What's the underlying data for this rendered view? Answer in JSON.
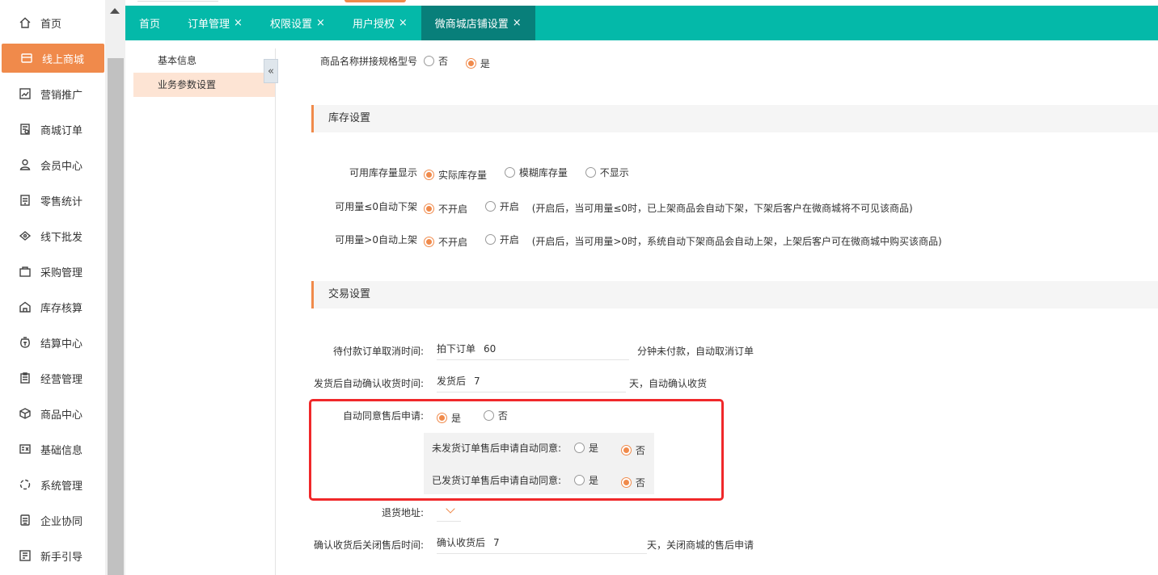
{
  "sidebar": {
    "items": [
      {
        "label": "首页",
        "icon": "home-icon"
      },
      {
        "label": "线上商城",
        "icon": "store-icon",
        "active": true
      },
      {
        "label": "营销推广",
        "icon": "chart-icon"
      },
      {
        "label": "商城订单",
        "icon": "order-icon"
      },
      {
        "label": "会员中心",
        "icon": "user-icon"
      },
      {
        "label": "零售统计",
        "icon": "stats-icon"
      },
      {
        "label": "线下批发",
        "icon": "wholesale-icon"
      },
      {
        "label": "采购管理",
        "icon": "bag-icon"
      },
      {
        "label": "库存核算",
        "icon": "warehouse-icon"
      },
      {
        "label": "结算中心",
        "icon": "money-icon"
      },
      {
        "label": "经营管理",
        "icon": "clipboard-icon"
      },
      {
        "label": "商品中心",
        "icon": "box-icon"
      },
      {
        "label": "基础信息",
        "icon": "id-card-icon"
      },
      {
        "label": "系统管理",
        "icon": "system-icon"
      },
      {
        "label": "企业协同",
        "icon": "cooperation-icon"
      },
      {
        "label": "新手引导",
        "icon": "guide-icon"
      }
    ]
  },
  "tabs": [
    {
      "label": "首页",
      "closable": false
    },
    {
      "label": "订单管理",
      "closable": true
    },
    {
      "label": "权限设置",
      "closable": true
    },
    {
      "label": "用户授权",
      "closable": true
    },
    {
      "label": "微商城店铺设置",
      "closable": true,
      "active": true
    }
  ],
  "tab_close_glyph": "×",
  "subnav": {
    "items": [
      "基本信息",
      "业务参数设置"
    ],
    "collapse_glyph": "«"
  },
  "content": {
    "product_name": {
      "label": "商品名称拼接规格型号",
      "options": [
        "否",
        "是"
      ],
      "selected": 1
    },
    "stock_section": {
      "title": "库存设置"
    },
    "stock_display": {
      "label": "可用库存量显示",
      "options": [
        "实际库存量",
        "模糊库存量",
        "不显示"
      ],
      "selected": 0
    },
    "auto_off_shelf": {
      "label": "可用量≤0自动下架",
      "options": [
        "不开启",
        "开启"
      ],
      "selected": 0,
      "note": "(开启后，当可用量≤0时，已上架商品会自动下架，下架后客户在微商城将不可见该商品)"
    },
    "auto_on_shelf": {
      "label": "可用量>0自动上架",
      "options": [
        "不开启",
        "开启"
      ],
      "selected": 0,
      "note": "(开启后，当可用量>0时，系统自动下架商品会自动上架，上架后客户可在微商城中购买该商品)"
    },
    "trade_section": {
      "title": "交易设置"
    },
    "cancel_unpaid": {
      "label": "待付款订单取消时间:",
      "prefix": "拍下订单",
      "value": "60",
      "suffix": "分钟未付款，自动取消订单"
    },
    "auto_confirm": {
      "label": "发货后自动确认收货时间:",
      "prefix": "发货后",
      "value": "7",
      "suffix": "天，自动确认收货"
    },
    "auto_after_sale": {
      "label": "自动同意售后申请:",
      "options": [
        "是",
        "否"
      ],
      "selected": 0
    },
    "unshipped_after_sale": {
      "label": "未发货订单售后申请自动同意:",
      "options": [
        "是",
        "否"
      ],
      "selected": 1
    },
    "shipped_after_sale": {
      "label": "已发货订单售后申请自动同意:",
      "options": [
        "是",
        "否"
      ],
      "selected": 1
    },
    "return_address": {
      "label": "退货地址:",
      "value": ""
    },
    "close_after_sale": {
      "label": "确认收货后关闭售后时间:",
      "prefix": "确认收货后",
      "value": "7",
      "suffix": "天，关闭商城的售后申请"
    }
  },
  "colors": {
    "accent": "#f08a4b",
    "tabbar": "#04b9a9",
    "tab_active": "#087f7a",
    "highlight_box": "#f0282a"
  }
}
